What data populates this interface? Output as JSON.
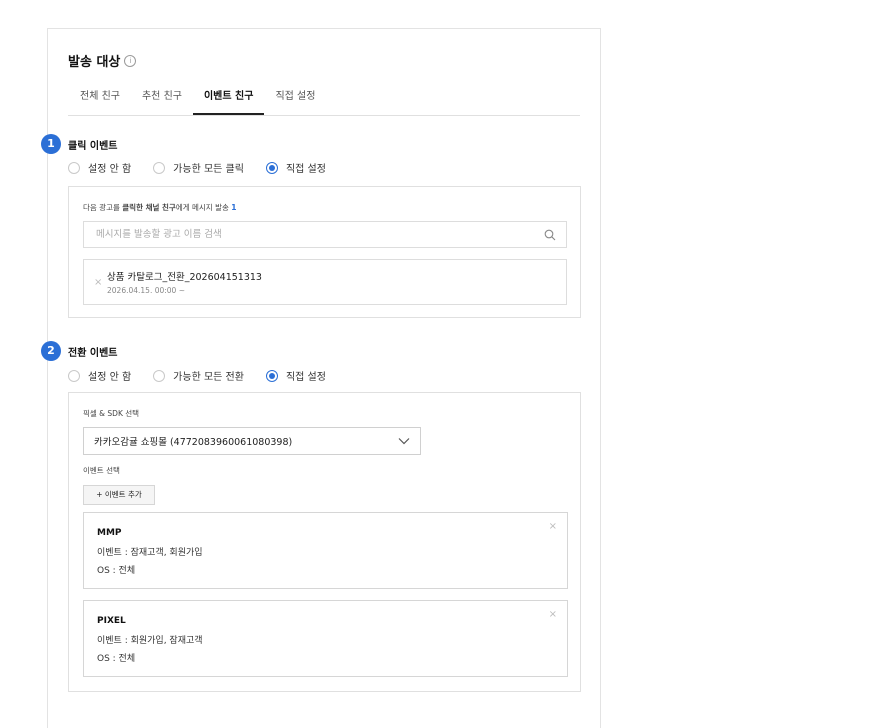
{
  "header": {
    "title": "발송 대상",
    "info_icon": "info-icon"
  },
  "tabs": [
    {
      "label": "전체 친구",
      "active": false
    },
    {
      "label": "추천 친구",
      "active": false
    },
    {
      "label": "이벤트 친구",
      "active": true
    },
    {
      "label": "직접 설정",
      "active": false
    }
  ],
  "click_event": {
    "step": "1",
    "title": "클릭 이벤트",
    "options": [
      {
        "label": "설정 안 함",
        "checked": false
      },
      {
        "label": "가능한 모든 클릭",
        "checked": false
      },
      {
        "label": "직접 설정",
        "checked": true
      }
    ],
    "desc_prefix": "다음 광고를 ",
    "desc_bold": "클릭한 채널 친구",
    "desc_suffix": "에게 메시지 발송",
    "desc_count": "1",
    "search_placeholder": "메시지를 발송할 광고 이름 검색",
    "selected_ad": {
      "name": "상품 카탈로그_전환_202604151313",
      "date": "2026.04.15. 00:00 ~"
    }
  },
  "conversion_event": {
    "step": "2",
    "title": "전환 이벤트",
    "options": [
      {
        "label": "설정 안 함",
        "checked": false
      },
      {
        "label": "가능한 모든 전환",
        "checked": false
      },
      {
        "label": "직접 설정",
        "checked": true
      }
    ],
    "pixel_label": "픽셀 & SDK 선택",
    "pixel_value": "카카오감귤 쇼핑몰 (4772083960061080398)",
    "event_select_label": "이벤트 선택",
    "add_event_button": "+ 이벤트 추가",
    "events": [
      {
        "type": "MMP",
        "events_line": "이벤트 : 잠재고객, 회원가입",
        "os_line": "OS : 전체"
      },
      {
        "type": "PIXEL",
        "events_line": "이벤트 : 회원가입, 잠재고객",
        "os_line": "OS : 전체"
      }
    ]
  },
  "colors": {
    "accent": "#2b6fd6",
    "border": "#e0e0e0"
  }
}
